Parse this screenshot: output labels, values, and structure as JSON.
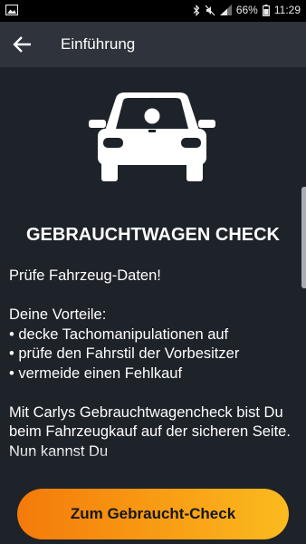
{
  "status_bar": {
    "battery_percent": "66%",
    "time": "11:29",
    "icons": [
      "image-icon",
      "bluetooth-icon",
      "mute-icon",
      "signal-icon",
      "battery-icon"
    ]
  },
  "app_bar": {
    "back_icon": "arrow-left-icon",
    "title": "Einführung"
  },
  "hero": {
    "icon": "car-with-lightbulb-icon"
  },
  "heading": "GEBRAUCHTWAGEN CHECK",
  "body": {
    "tagline": "Prüfe Fahrzeug-Daten!",
    "advantages_title": "Deine Vorteile:",
    "advantages": [
      "• decke Tachomanipulationen auf",
      "• prüfe den Fahrstil der Vorbesitzer",
      "• vermeide einen Fehlkauf"
    ],
    "description": "Mit Carlys Gebrauchtwagencheck bist Du beim Fahrzeugkauf auf der sicheren Seite. Nun kannst Du"
  },
  "cta": {
    "label": "Zum Gebraucht-Check"
  },
  "colors": {
    "background": "#1e2229",
    "app_bar": "#2f333b",
    "accent_start": "#f47a0b",
    "accent_end": "#fbbb1f"
  }
}
